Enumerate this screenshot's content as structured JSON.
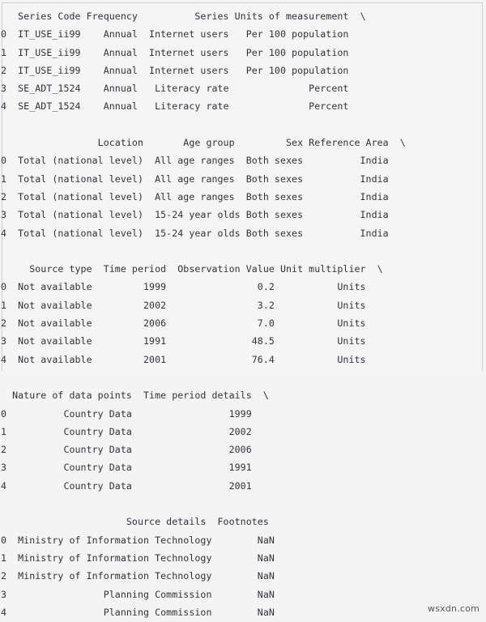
{
  "window": {
    "background_color": "#f4f4f4",
    "text_color": "#32323a",
    "border_color": "#cfcfcf"
  },
  "watermark": {
    "text": "wsxdn.com"
  },
  "dataframe": {
    "index": [
      "0",
      "1",
      "2",
      "3",
      "4"
    ],
    "columns": [
      "Series Code",
      "Frequency",
      "Series",
      "Units of measurement",
      "Location",
      "Age group",
      "Sex",
      "Reference Area",
      "Source type",
      "Time period",
      "Observation Value",
      "Unit multiplier",
      "Nature of data points",
      "Time period details",
      "Source details",
      "Footnotes"
    ],
    "rows": [
      {
        "index": "0",
        "Series Code": "IT_USE_ii99",
        "Frequency": "Annual",
        "Series": "Internet users",
        "Units of measurement": "Per 100 population",
        "Location": "Total (national level)",
        "Age group": "All age ranges",
        "Sex": "Both sexes",
        "Reference Area": "India",
        "Source type": "Not available",
        "Time period": "1999",
        "Observation Value": "0.2",
        "Unit multiplier": "Units",
        "Nature of data points": "Country Data",
        "Time period details": "1999",
        "Source details": "Ministry of Information Technology",
        "Footnotes": "NaN"
      },
      {
        "index": "1",
        "Series Code": "IT_USE_ii99",
        "Frequency": "Annual",
        "Series": "Internet users",
        "Units of measurement": "Per 100 population",
        "Location": "Total (national level)",
        "Age group": "All age ranges",
        "Sex": "Both sexes",
        "Reference Area": "India",
        "Source type": "Not available",
        "Time period": "2002",
        "Observation Value": "3.2",
        "Unit multiplier": "Units",
        "Nature of data points": "Country Data",
        "Time period details": "2002",
        "Source details": "Ministry of Information Technology",
        "Footnotes": "NaN"
      },
      {
        "index": "2",
        "Series Code": "IT_USE_ii99",
        "Frequency": "Annual",
        "Series": "Internet users",
        "Units of measurement": "Per 100 population",
        "Location": "Total (national level)",
        "Age group": "All age ranges",
        "Sex": "Both sexes",
        "Reference Area": "India",
        "Source type": "Not available",
        "Time period": "2006",
        "Observation Value": "7.0",
        "Unit multiplier": "Units",
        "Nature of data points": "Country Data",
        "Time period details": "2006",
        "Source details": "Ministry of Information Technology",
        "Footnotes": "NaN"
      },
      {
        "index": "3",
        "Series Code": "SE_ADT_1524",
        "Frequency": "Annual",
        "Series": "Literacy rate",
        "Units of measurement": "Percent",
        "Location": "Total (national level)",
        "Age group": "15-24 year olds",
        "Sex": "Both sexes",
        "Reference Area": "India",
        "Source type": "Not available",
        "Time period": "1991",
        "Observation Value": "48.5",
        "Unit multiplier": "Units",
        "Nature of data points": "Country Data",
        "Time period details": "1991",
        "Source details": "Planning Commission",
        "Footnotes": "NaN"
      },
      {
        "index": "4",
        "Series Code": "SE_ADT_1524",
        "Frequency": "Annual",
        "Series": "Literacy rate",
        "Units of measurement": "Percent",
        "Location": "Total (national level)",
        "Age group": "15-24 year olds",
        "Sex": "Both sexes",
        "Reference Area": "India",
        "Source type": "Not available",
        "Time period": "2001",
        "Observation Value": "76.4",
        "Unit multiplier": "Units",
        "Nature of data points": "Country Data",
        "Time period details": "2001",
        "Source details": "Planning Commission",
        "Footnotes": "NaN"
      }
    ],
    "wrapped_blocks": [
      {
        "name": "block-1",
        "continuation_marker": "\\",
        "lines": [
          "   Series Code Frequency          Series Units of measurement  \\",
          "0  IT_USE_ii99    Annual  Internet users   Per 100 population   ",
          "1  IT_USE_ii99    Annual  Internet users   Per 100 population   ",
          "2  IT_USE_ii99    Annual  Internet users   Per 100 population   ",
          "3  SE_ADT_1524    Annual   Literacy rate              Percent   ",
          "4  SE_ADT_1524    Annual   Literacy rate              Percent   "
        ]
      },
      {
        "name": "block-2",
        "continuation_marker": "\\",
        "lines": [
          "                 Location       Age group         Sex Reference Area  \\",
          "0  Total (national level)  All age ranges  Both sexes          India   ",
          "1  Total (national level)  All age ranges  Both sexes          India   ",
          "2  Total (national level)  All age ranges  Both sexes          India   ",
          "3  Total (national level)  15-24 year olds Both sexes          India   ",
          "4  Total (national level)  15-24 year olds Both sexes          India   "
        ]
      },
      {
        "name": "block-3",
        "continuation_marker": "\\",
        "lines": [
          "     Source type  Time period  Observation Value Unit multiplier  \\",
          "0  Not available         1999                0.2           Units   ",
          "1  Not available         2002                3.2           Units   ",
          "2  Not available         2006                7.0           Units   ",
          "3  Not available         1991               48.5           Units   ",
          "4  Not available         2001               76.4           Units   "
        ]
      },
      {
        "name": "block-4",
        "continuation_marker": "\\",
        "lines": [
          "  Nature of data points  Time period details  \\",
          "0          Country Data                 1999   ",
          "1          Country Data                 2002   ",
          "2          Country Data                 2006   ",
          "3          Country Data                 1991   ",
          "4          Country Data                 2001   "
        ]
      },
      {
        "name": "block-5",
        "continuation_marker": "",
        "lines": [
          "                      Source details  Footnotes",
          "0  Ministry of Information Technology        NaN",
          "1  Ministry of Information Technology        NaN",
          "2  Ministry of Information Technology        NaN",
          "3                 Planning Commission        NaN",
          "4                 Planning Commission        NaN"
        ]
      }
    ]
  }
}
